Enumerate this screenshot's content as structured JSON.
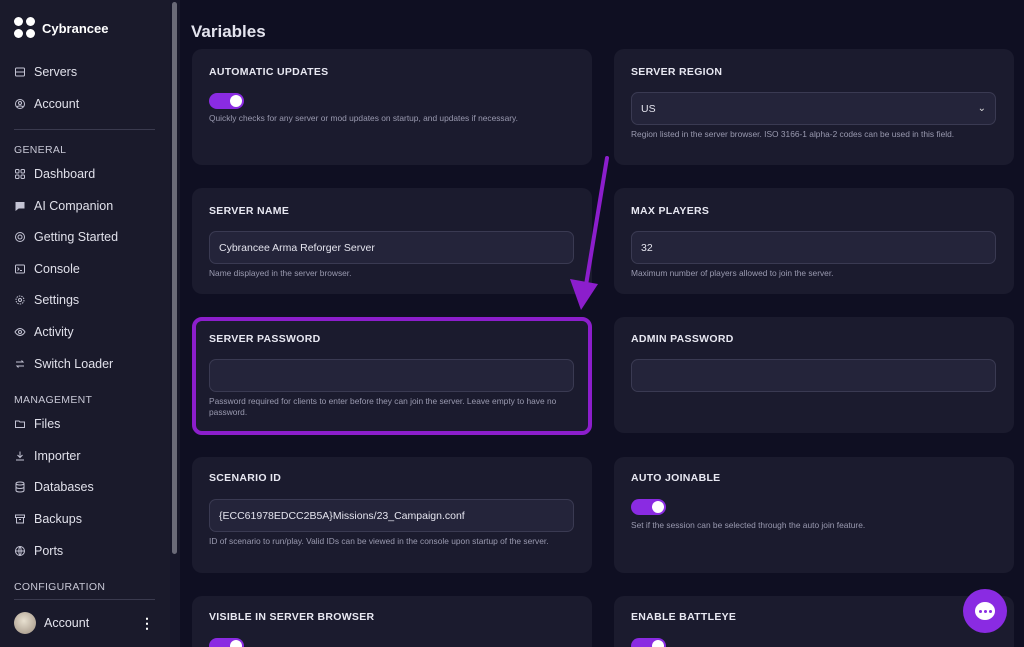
{
  "brand": {
    "name": "Cybrancee"
  },
  "sidebar": {
    "top_items": [
      {
        "label": "Servers",
        "icon": "server-icon"
      },
      {
        "label": "Account",
        "icon": "user-circle-icon"
      }
    ],
    "general_label": "GENERAL",
    "general_items": [
      {
        "label": "Dashboard",
        "icon": "grid-icon"
      },
      {
        "label": "AI Companion",
        "icon": "chat-icon"
      },
      {
        "label": "Getting Started",
        "icon": "lifebuoy-icon"
      },
      {
        "label": "Console",
        "icon": "terminal-icon"
      },
      {
        "label": "Settings",
        "icon": "gear-icon"
      },
      {
        "label": "Activity",
        "icon": "eye-icon"
      },
      {
        "label": "Switch Loader",
        "icon": "swap-icon"
      }
    ],
    "management_label": "MANAGEMENT",
    "management_items": [
      {
        "label": "Files",
        "icon": "folder-icon"
      },
      {
        "label": "Importer",
        "icon": "download-icon"
      },
      {
        "label": "Databases",
        "icon": "database-icon"
      },
      {
        "label": "Backups",
        "icon": "archive-icon"
      },
      {
        "label": "Ports",
        "icon": "globe-icon"
      }
    ],
    "configuration_label": "CONFIGURATION",
    "account_label": "Account"
  },
  "page": {
    "title": "Variables"
  },
  "cards": {
    "automatic_updates": {
      "title": "AUTOMATIC UPDATES",
      "enabled": true,
      "help": "Quickly checks for any server or mod updates on startup, and updates if necessary."
    },
    "server_region": {
      "title": "SERVER REGION",
      "value": "US",
      "help": "Region listed in the server browser. ISO 3166-1 alpha-2 codes can be used in this field."
    },
    "server_name": {
      "title": "SERVER NAME",
      "value": "Cybrancee Arma Reforger Server",
      "help": "Name displayed in the server browser."
    },
    "max_players": {
      "title": "MAX PLAYERS",
      "value": "32",
      "help": "Maximum number of players allowed to join the server."
    },
    "server_password": {
      "title": "SERVER PASSWORD",
      "value": "",
      "help": "Password required for clients to enter before they can join the server. Leave empty to have no password."
    },
    "admin_password": {
      "title": "ADMIN PASSWORD",
      "value": ""
    },
    "scenario_id": {
      "title": "SCENARIO ID",
      "value": "{ECC61978EDCC2B5A}Missions/23_Campaign.conf",
      "help": "ID of scenario to run/play. Valid IDs can be viewed in the console upon startup of the server."
    },
    "auto_joinable": {
      "title": "AUTO JOINABLE",
      "enabled": true,
      "help": "Set if the session can be selected through the auto join feature."
    },
    "visible_in_browser": {
      "title": "VISIBLE IN SERVER BROWSER",
      "enabled": true
    },
    "enable_battleye": {
      "title": "ENABLE BATTLEYE",
      "enabled": true
    }
  },
  "colors": {
    "accent": "#8a2be2",
    "highlight": "#8c1ecc",
    "background": "#0f0f22",
    "card": "#1b1b2e",
    "sidebar": "#1a1a2b"
  }
}
